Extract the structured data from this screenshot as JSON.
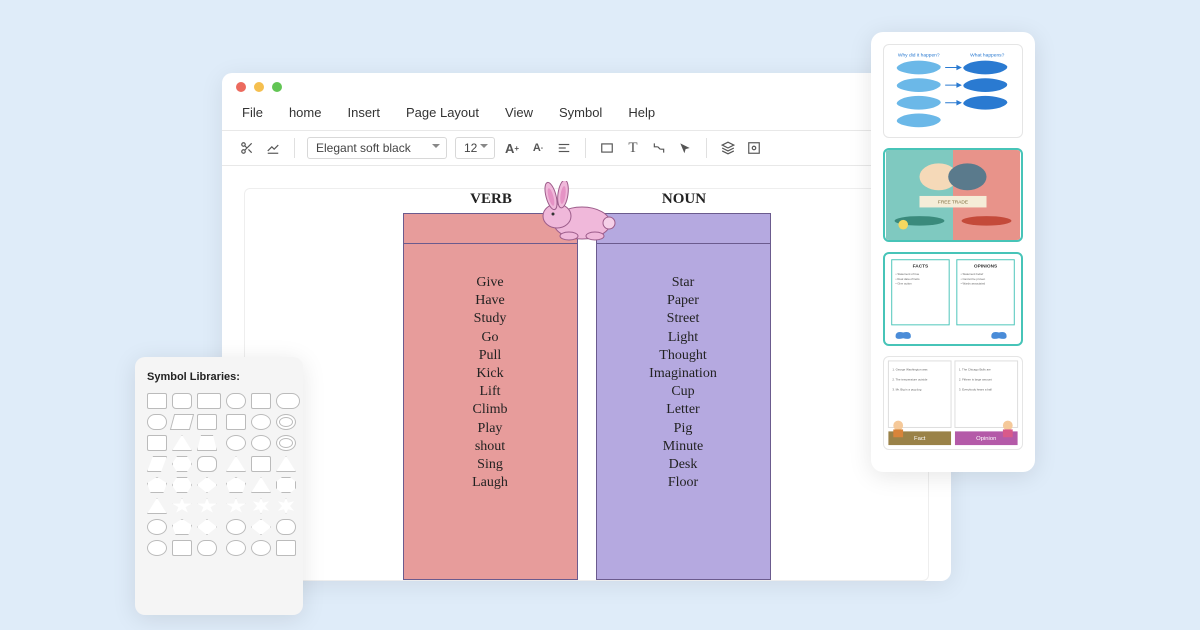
{
  "menu": {
    "file": "File",
    "home": "home",
    "insert": "Insert",
    "pageLayout": "Page Layout",
    "view": "View",
    "symbol": "Symbol",
    "help": "Help"
  },
  "toolbar": {
    "font": "Elegant soft black",
    "size": "12"
  },
  "tchart": {
    "verb": {
      "header": "VERB",
      "items": [
        "Give",
        "Have",
        "Study",
        "Go",
        "Pull",
        "Kick",
        "Lift",
        "Climb",
        "Play",
        "shout",
        "Sing",
        "Laugh"
      ]
    },
    "noun": {
      "header": "NOUN",
      "items": [
        "Star",
        "Paper",
        "Street",
        "Light",
        "Thought",
        "Imagination",
        "Cup",
        "Letter",
        "Pig",
        "Minute",
        "Desk",
        "Floor"
      ]
    }
  },
  "panels": {
    "symbolLibraries": "Symbol Libraries:"
  },
  "templates": {
    "t1": {
      "left": "Why did it happen?",
      "right": "What happens?"
    },
    "t2": {
      "title": "FREE TRADE"
    },
    "t3": {
      "left": "FACTS",
      "right": "OPINIONS"
    },
    "t4": {
      "left": "Fact",
      "right": "Opinion"
    }
  }
}
